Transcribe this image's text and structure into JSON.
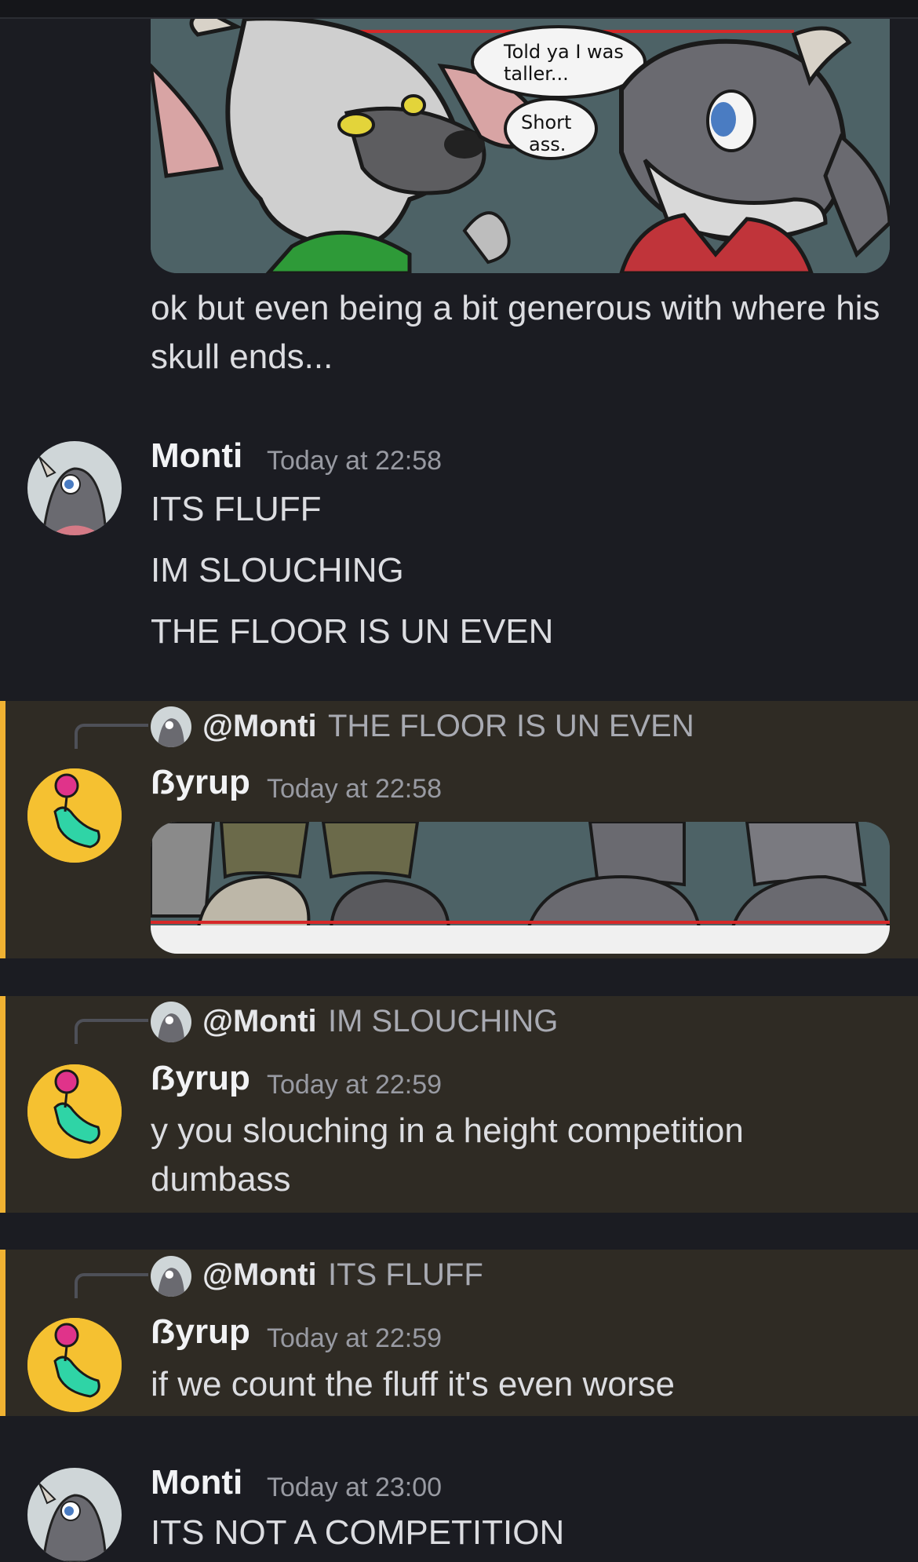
{
  "messages": [
    {
      "text": "ok but even being a bit generous with where his skull ends..."
    },
    {
      "author": "Monti",
      "timestamp": "Today at 22:58",
      "lines": [
        "ITS FLUFF",
        "IM SLOUCHING",
        "THE FLOOR IS UN EVEN"
      ]
    },
    {
      "author": "ẞyrup",
      "timestamp": "Today at 22:58",
      "reply_to": {
        "mention": "@Monti",
        "text": "THE FLOOR IS UN EVEN"
      }
    },
    {
      "author": "ẞyrup",
      "timestamp": "Today at 22:59",
      "reply_to": {
        "mention": "@Monti",
        "text": "IM SLOUCHING"
      },
      "text": "y you slouching in a height competition dumbass"
    },
    {
      "author": "ẞyrup",
      "timestamp": "Today at 22:59",
      "reply_to": {
        "mention": "@Monti",
        "text": "ITS FLUFF"
      },
      "text": "if we count the fluff it's even worse"
    },
    {
      "author": "Monti",
      "timestamp": "Today at 23:00",
      "lines": [
        "ITS NOT A COMPETITION"
      ]
    }
  ],
  "comic": {
    "bubble1": [
      "Told ya I was",
      "taller..."
    ],
    "bubble2": [
      "Short",
      "ass."
    ]
  },
  "colors": {
    "background": "#1b1c22",
    "mention_highlight": "#2f2b24",
    "mention_bar": "#f0b232",
    "avatar_byrup": "#f5c131"
  }
}
